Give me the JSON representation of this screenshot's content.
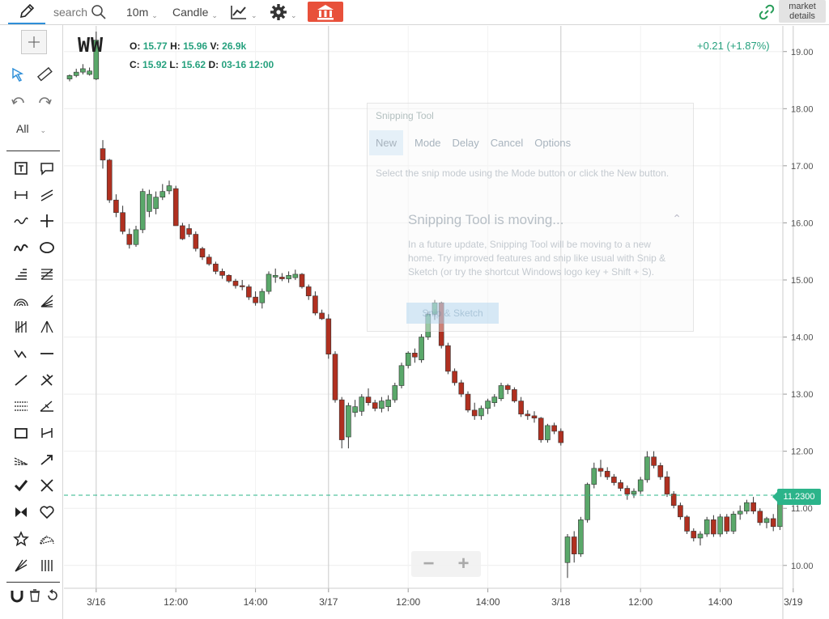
{
  "toolbar": {
    "search_placeholder": "search",
    "interval": "10m",
    "chart_type": "Candle",
    "market_details_line1": "market",
    "market_details_line2": "details"
  },
  "icons": {
    "pencil": "pencil-icon",
    "search": "search-icon",
    "indicator": "line-chart-icon",
    "settings": "gear-icon",
    "bank": "bank-icon",
    "link": "link-icon"
  },
  "left_toolbar": {
    "filter": "All"
  },
  "instrument": {
    "symbol": "WW",
    "open_label": "O:",
    "open": "15.77",
    "high_label": "H:",
    "high": "15.96",
    "volume_label": "V:",
    "volume": "26.9k",
    "close_label": "C:",
    "close": "15.92",
    "low_label": "L:",
    "low": "15.62",
    "date_label": "D:",
    "date": "03-16 12:00",
    "change": "+0.21 (+1.87%)",
    "last_price": "11.2300"
  },
  "zoom": {
    "out": "−",
    "in": "+"
  },
  "snipping_tool": {
    "title": "Snipping Tool",
    "new": "New",
    "mode": "Mode",
    "delay": "Delay",
    "cancel": "Cancel",
    "options": "Options",
    "hint": "Select the snip mode using the Mode button or click the New button.",
    "moving_title": "Snipping Tool is moving...",
    "moving_body": "In a future update, Snipping Tool will be moving to a new home. Try improved features and snip like usual with Snip & Sketch (or try the shortcut Windows logo key + Shift + S).",
    "snip_sketch": "Snip & Sketch"
  },
  "colors": {
    "up": "#5aa86a",
    "down": "#b03020",
    "accent": "#2bb48a",
    "bank": "#e8503a"
  },
  "chart_data": {
    "type": "candlestick",
    "y_ticks": [
      "19.00",
      "18.00",
      "17.00",
      "16.00",
      "15.00",
      "14.00",
      "13.00",
      "12.00",
      "11.00",
      "10.00"
    ],
    "ylim": [
      9.6,
      19.45
    ],
    "x_ticks": [
      {
        "label": "3/16",
        "bar": 4
      },
      {
        "label": "12:00",
        "bar": 16
      },
      {
        "label": "14:00",
        "bar": 28
      },
      {
        "label": "3/17",
        "bar": 39
      },
      {
        "label": "12:00",
        "bar": 51
      },
      {
        "label": "14:00",
        "bar": 63
      },
      {
        "label": "3/18",
        "bar": 74
      },
      {
        "label": "12:00",
        "bar": 86
      },
      {
        "label": "14:00",
        "bar": 98
      },
      {
        "label": "3/19",
        "bar": 109
      }
    ],
    "session_breaks": [
      4,
      39,
      74,
      109
    ],
    "last_price": 11.23,
    "candles": [
      [
        18.52,
        18.6,
        18.48,
        18.58
      ],
      [
        18.58,
        18.7,
        18.55,
        18.64
      ],
      [
        18.64,
        18.78,
        18.6,
        18.7
      ],
      [
        18.6,
        18.72,
        18.58,
        18.66
      ],
      [
        18.52,
        19.35,
        18.5,
        19.2
      ],
      [
        17.3,
        17.45,
        16.95,
        17.1
      ],
      [
        17.1,
        17.12,
        16.35,
        16.4
      ],
      [
        16.4,
        16.5,
        16.1,
        16.18
      ],
      [
        16.18,
        16.3,
        15.8,
        15.85
      ],
      [
        15.8,
        15.9,
        15.55,
        15.62
      ],
      [
        15.62,
        15.95,
        15.58,
        15.88
      ],
      [
        15.88,
        16.6,
        15.82,
        16.55
      ],
      [
        16.2,
        16.58,
        16.1,
        16.5
      ],
      [
        16.25,
        16.55,
        16.15,
        16.45
      ],
      [
        16.45,
        16.68,
        16.4,
        16.55
      ],
      [
        16.56,
        16.74,
        16.5,
        16.65
      ],
      [
        16.6,
        16.65,
        15.95,
        15.95
      ],
      [
        15.95,
        16.0,
        15.7,
        15.72
      ],
      [
        15.9,
        15.98,
        15.75,
        15.8
      ],
      [
        15.8,
        15.85,
        15.5,
        15.55
      ],
      [
        15.55,
        15.58,
        15.35,
        15.4
      ],
      [
        15.4,
        15.45,
        15.25,
        15.28
      ],
      [
        15.28,
        15.32,
        15.1,
        15.15
      ],
      [
        15.15,
        15.2,
        15.02,
        15.08
      ],
      [
        15.08,
        15.1,
        14.95,
        14.98
      ],
      [
        14.98,
        15.02,
        14.85,
        14.9
      ],
      [
        14.9,
        15.0,
        14.82,
        14.88
      ],
      [
        14.88,
        14.92,
        14.65,
        14.7
      ],
      [
        14.7,
        14.8,
        14.55,
        14.6
      ],
      [
        14.6,
        14.85,
        14.5,
        14.8
      ],
      [
        14.8,
        15.15,
        14.75,
        15.1
      ],
      [
        15.05,
        15.2,
        14.95,
        15.08
      ],
      [
        15.05,
        15.12,
        14.98,
        15.02
      ],
      [
        15.02,
        15.15,
        14.95,
        15.08
      ],
      [
        15.04,
        15.18,
        15.0,
        15.1
      ],
      [
        15.1,
        15.12,
        14.85,
        14.88
      ],
      [
        14.88,
        14.92,
        14.65,
        14.72
      ],
      [
        14.72,
        14.8,
        14.38,
        14.42
      ],
      [
        14.42,
        14.48,
        14.3,
        14.32
      ],
      [
        14.32,
        14.4,
        13.62,
        13.7
      ],
      [
        13.7,
        13.75,
        12.85,
        12.9
      ],
      [
        12.9,
        12.95,
        12.05,
        12.2
      ],
      [
        12.25,
        12.85,
        12.05,
        12.8
      ],
      [
        12.68,
        12.9,
        12.6,
        12.78
      ],
      [
        12.7,
        13.0,
        12.62,
        12.95
      ],
      [
        12.95,
        13.1,
        12.8,
        12.85
      ],
      [
        12.85,
        12.9,
        12.7,
        12.75
      ],
      [
        12.75,
        12.95,
        12.68,
        12.88
      ],
      [
        12.78,
        12.98,
        12.7,
        12.9
      ],
      [
        12.9,
        13.2,
        12.85,
        13.15
      ],
      [
        13.15,
        13.55,
        13.1,
        13.5
      ],
      [
        13.5,
        13.75,
        13.45,
        13.72
      ],
      [
        13.72,
        13.8,
        13.55,
        13.65
      ],
      [
        13.6,
        14.05,
        13.55,
        14.0
      ],
      [
        14.0,
        14.45,
        13.95,
        14.4
      ],
      [
        14.4,
        14.65,
        14.3,
        14.6
      ],
      [
        14.6,
        14.62,
        13.8,
        13.85
      ],
      [
        13.85,
        13.9,
        13.35,
        13.4
      ],
      [
        13.4,
        13.45,
        13.15,
        13.2
      ],
      [
        13.2,
        13.25,
        12.95,
        13.0
      ],
      [
        13.0,
        13.05,
        12.68,
        12.72
      ],
      [
        12.72,
        12.85,
        12.55,
        12.62
      ],
      [
        12.62,
        12.8,
        12.55,
        12.75
      ],
      [
        12.75,
        12.92,
        12.65,
        12.88
      ],
      [
        12.85,
        13.0,
        12.78,
        12.95
      ],
      [
        12.92,
        13.2,
        12.88,
        13.15
      ],
      [
        13.15,
        13.18,
        13.0,
        13.08
      ],
      [
        13.08,
        13.12,
        12.85,
        12.88
      ],
      [
        12.88,
        12.95,
        12.6,
        12.65
      ],
      [
        12.65,
        12.72,
        12.55,
        12.62
      ],
      [
        12.62,
        12.7,
        12.5,
        12.58
      ],
      [
        12.58,
        12.6,
        12.15,
        12.2
      ],
      [
        12.2,
        12.48,
        12.15,
        12.45
      ],
      [
        12.45,
        12.5,
        12.3,
        12.35
      ],
      [
        12.35,
        12.4,
        12.1,
        12.15
      ],
      [
        10.05,
        10.55,
        9.78,
        10.5
      ],
      [
        10.5,
        10.6,
        10.05,
        10.2
      ],
      [
        10.2,
        10.85,
        10.15,
        10.8
      ],
      [
        10.8,
        11.45,
        10.75,
        11.42
      ],
      [
        11.42,
        11.8,
        11.35,
        11.7
      ],
      [
        11.7,
        11.85,
        11.55,
        11.65
      ],
      [
        11.65,
        11.72,
        11.5,
        11.55
      ],
      [
        11.55,
        11.6,
        11.4,
        11.45
      ],
      [
        11.45,
        11.5,
        11.3,
        11.35
      ],
      [
        11.35,
        11.4,
        11.15,
        11.25
      ],
      [
        11.25,
        11.35,
        11.18,
        11.3
      ],
      [
        11.3,
        11.55,
        11.25,
        11.5
      ],
      [
        11.5,
        12.0,
        11.45,
        11.9
      ],
      [
        11.9,
        12.0,
        11.7,
        11.75
      ],
      [
        11.75,
        11.8,
        11.5,
        11.55
      ],
      [
        11.55,
        11.65,
        11.2,
        11.25
      ],
      [
        11.25,
        11.3,
        11.0,
        11.05
      ],
      [
        11.05,
        11.1,
        10.8,
        10.85
      ],
      [
        10.85,
        10.88,
        10.55,
        10.6
      ],
      [
        10.6,
        10.65,
        10.42,
        10.48
      ],
      [
        10.48,
        10.6,
        10.35,
        10.55
      ],
      [
        10.55,
        10.85,
        10.5,
        10.8
      ],
      [
        10.8,
        10.88,
        10.5,
        10.55
      ],
      [
        10.55,
        10.9,
        10.5,
        10.85
      ],
      [
        10.85,
        10.9,
        10.55,
        10.6
      ],
      [
        10.6,
        10.95,
        10.55,
        10.9
      ],
      [
        10.9,
        11.05,
        10.8,
        10.95
      ],
      [
        10.95,
        11.15,
        10.9,
        11.1
      ],
      [
        11.1,
        11.2,
        10.9,
        10.95
      ],
      [
        10.95,
        11.0,
        10.7,
        10.75
      ],
      [
        10.75,
        10.85,
        10.65,
        10.82
      ],
      [
        10.82,
        10.9,
        10.6,
        10.68
      ],
      [
        10.68,
        11.25,
        10.62,
        11.2
      ]
    ]
  }
}
